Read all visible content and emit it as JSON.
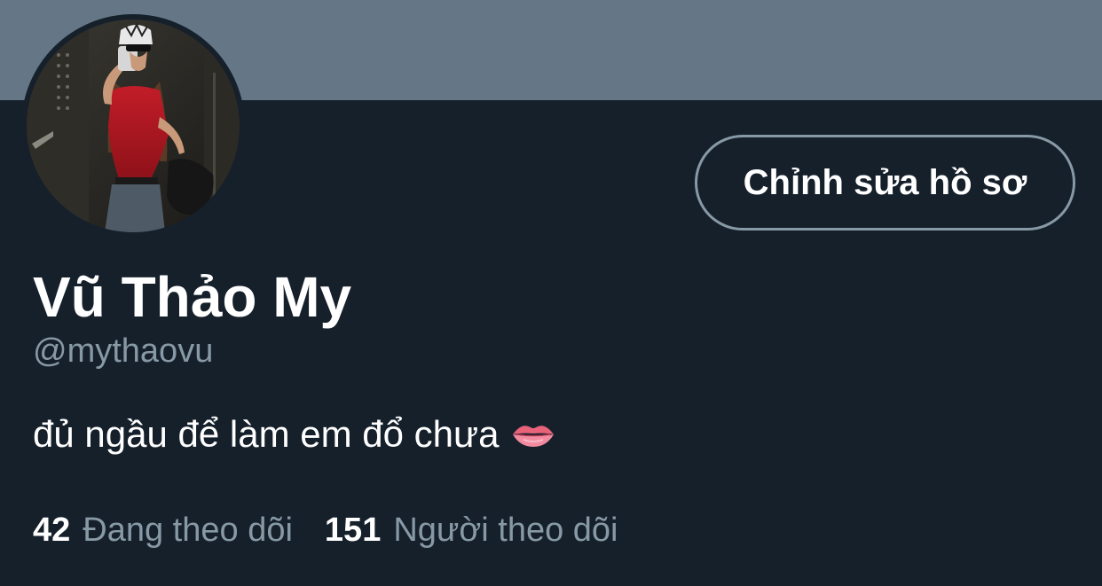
{
  "profile": {
    "display_name": "Vũ Thảo My",
    "handle": "@mythaovu",
    "bio": "đủ ngầu để làm em đổ chưa",
    "bio_icon": "lips-emoji-icon",
    "edit_button_label": "Chỉnh sửa hồ sơ"
  },
  "stats": {
    "following_count": "42",
    "following_label": "Đang theo dõi",
    "followers_count": "151",
    "followers_label": "Người theo dõi"
  },
  "colors": {
    "background": "#15202b",
    "banner": "#657786",
    "secondary_text": "#8899a6",
    "button_border": "#8899a6"
  }
}
